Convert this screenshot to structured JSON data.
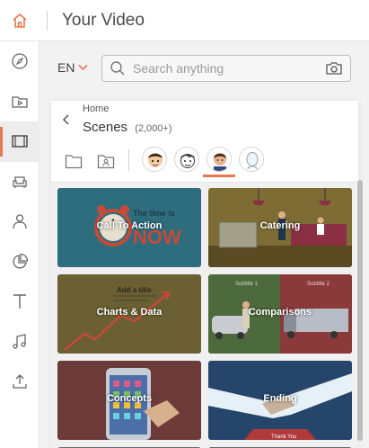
{
  "app": {
    "title": "Your Video"
  },
  "colors": {
    "accent": "#e8784f"
  },
  "rail": {
    "items": [
      {
        "icon": "compass-icon"
      },
      {
        "icon": "media-folder-icon"
      },
      {
        "icon": "film-icon",
        "active": true
      },
      {
        "icon": "armchair-icon"
      },
      {
        "icon": "person-icon"
      },
      {
        "icon": "pie-chart-icon"
      },
      {
        "icon": "text-icon"
      },
      {
        "icon": "music-icon"
      },
      {
        "icon": "upload-icon"
      }
    ]
  },
  "toolbar": {
    "language": "EN",
    "search_placeholder": "Search anything"
  },
  "scenes": {
    "breadcrumb": "Home",
    "title": "Scenes",
    "count": "(2,000+)"
  },
  "tiles": [
    {
      "label": "Call To Action",
      "bg": "#2d6d7e",
      "art_text_1": "The time is",
      "art_text_2": "NOW"
    },
    {
      "label": "Catering",
      "bg": "#7d6d34"
    },
    {
      "label": "Charts & Data",
      "bg": "#6a6033",
      "art_text_1": "Add a title"
    },
    {
      "label": "Comparisons",
      "bg": "#4c6a3c",
      "art_text_1": "Subtitle 1",
      "art_text_2": "Subtitle 2"
    },
    {
      "label": "Concepts",
      "bg": "#6d3a3a"
    },
    {
      "label": "Ending",
      "bg": "#26456a",
      "art_text_1": "Thank You"
    }
  ]
}
